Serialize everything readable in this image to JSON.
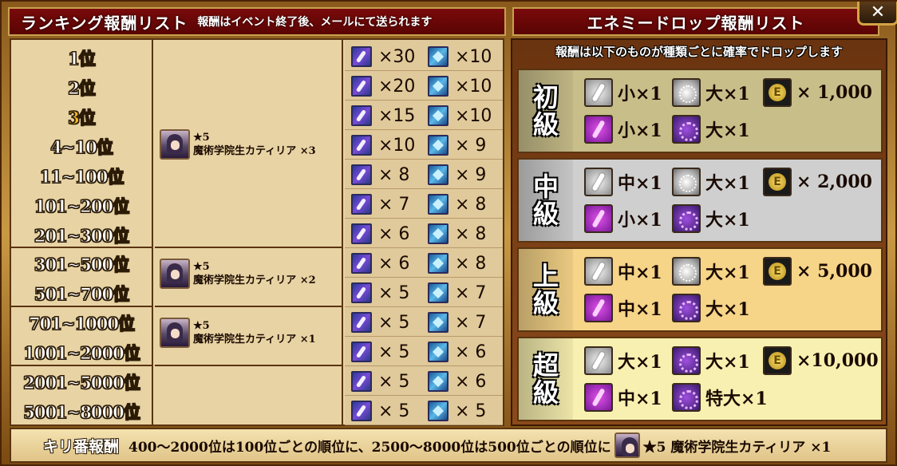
{
  "header": {
    "left_title": "ランキング報酬リスト",
    "left_subtitle": "報酬はイベント終了後、メールにて送られます",
    "right_title": "エネミードロップ報酬リスト",
    "close_label": "✕"
  },
  "ranking": {
    "ranks": [
      "1位",
      "2位",
      "3位",
      "4~10位",
      "11~100位",
      "101~200位",
      "201~300位",
      "301~500位",
      "501~700位",
      "701~1000位",
      "1001~2000位",
      "2001~5000位",
      "5001~8000位"
    ],
    "unit_rewards": [
      {
        "star": "★5",
        "name": "魔術学院生カティリア ×3"
      },
      {
        "star": "★5",
        "name": "魔術学院生カティリア ×2"
      },
      {
        "star": "★5",
        "name": "魔術学院生カティリア ×1"
      }
    ],
    "items": [
      {
        "feather": "×30",
        "gem": "×10"
      },
      {
        "feather": "×20",
        "gem": "×10"
      },
      {
        "feather": "×15",
        "gem": "×10"
      },
      {
        "feather": "×10",
        "gem": "× 9"
      },
      {
        "feather": "× 8",
        "gem": "× 9"
      },
      {
        "feather": "× 7",
        "gem": "× 8"
      },
      {
        "feather": "× 6",
        "gem": "× 8"
      },
      {
        "feather": "× 6",
        "gem": "× 8"
      },
      {
        "feather": "× 5",
        "gem": "× 7"
      },
      {
        "feather": "× 5",
        "gem": "× 7"
      },
      {
        "feather": "× 5",
        "gem": "× 6"
      },
      {
        "feather": "× 5",
        "gem": "× 6"
      },
      {
        "feather": "× 5",
        "gem": "× 5"
      }
    ]
  },
  "drops": {
    "subtitle": "報酬は以下のものが種類ごとに確率でドロップします",
    "tiers": [
      {
        "label1": "初",
        "label2": "級",
        "a": "小×1",
        "b": "大×1",
        "coin": "× 1,000",
        "c": "小×1",
        "d": "大×1"
      },
      {
        "label1": "中",
        "label2": "級",
        "a": "中×1",
        "b": "大×1",
        "coin": "× 2,000",
        "c": "小×1",
        "d": "大×1"
      },
      {
        "label1": "上",
        "label2": "級",
        "a": "中×1",
        "b": "大×1",
        "coin": "× 5,000",
        "c": "中×1",
        "d": "大×1"
      },
      {
        "label1": "超",
        "label2": "級",
        "a": "大×1",
        "b": "大×1",
        "coin": "×10,000",
        "c": "中×1",
        "d": "特大×1"
      }
    ],
    "tier_colors": [
      "#c8be8a",
      "#cfcfcf",
      "#f6d488",
      "#f8f0b0"
    ]
  },
  "footer": {
    "label": "キリ番報酬",
    "text": "400～2000位は100位ごとの順位に、2500～8000位は500位ごとの順位に",
    "unit": "★5 魔術学院生カティリア ×1"
  }
}
